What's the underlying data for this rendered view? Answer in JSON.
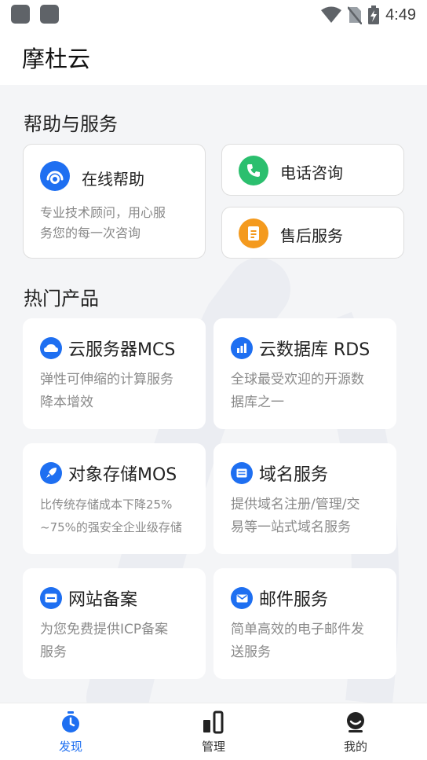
{
  "status_bar": {
    "time": "4:49"
  },
  "app": {
    "title": "摩杜云"
  },
  "help": {
    "heading": "帮助与服务",
    "online": {
      "title": "在线帮助",
      "desc_line1": "专业技术顾问，用心服",
      "desc_line2": "务您的每一次咨询"
    },
    "phone": {
      "title": "电话咨询"
    },
    "after_sales": {
      "title": "售后服务"
    }
  },
  "products": {
    "heading": "热门产品",
    "items": [
      {
        "title": "云服务器MCS",
        "desc_line1": "弹性可伸缩的计算服务",
        "desc_line2": "降本增效"
      },
      {
        "title": "云数据库 RDS",
        "desc_line1": "全球最受欢迎的开源数",
        "desc_line2": "据库之一"
      },
      {
        "title": "对象存储MOS",
        "desc_line1": "比传统存储成本下降25%",
        "desc_line2": "~75%的强安全企业级存储"
      },
      {
        "title": "域名服务",
        "desc_line1": "提供域名注册/管理/交",
        "desc_line2": "易等一站式域名服务"
      },
      {
        "title": "网站备案",
        "desc_line1": "为您免费提供ICP备案",
        "desc_line2": "服务"
      },
      {
        "title": "邮件服务",
        "desc_line1": "简单高效的电子邮件发",
        "desc_line2": "送服务"
      }
    ]
  },
  "bottom_nav": {
    "items": [
      {
        "label": "发现",
        "icon": "discover-icon",
        "active": true
      },
      {
        "label": "管理",
        "icon": "manage-icon",
        "active": false
      },
      {
        "label": "我的",
        "icon": "profile-icon",
        "active": false
      }
    ]
  },
  "colors": {
    "accent": "#1e6ff1",
    "phone_green": "#2bbf6e",
    "after_sales_orange": "#f49a1e",
    "nav_active": "#1e6ff1"
  }
}
